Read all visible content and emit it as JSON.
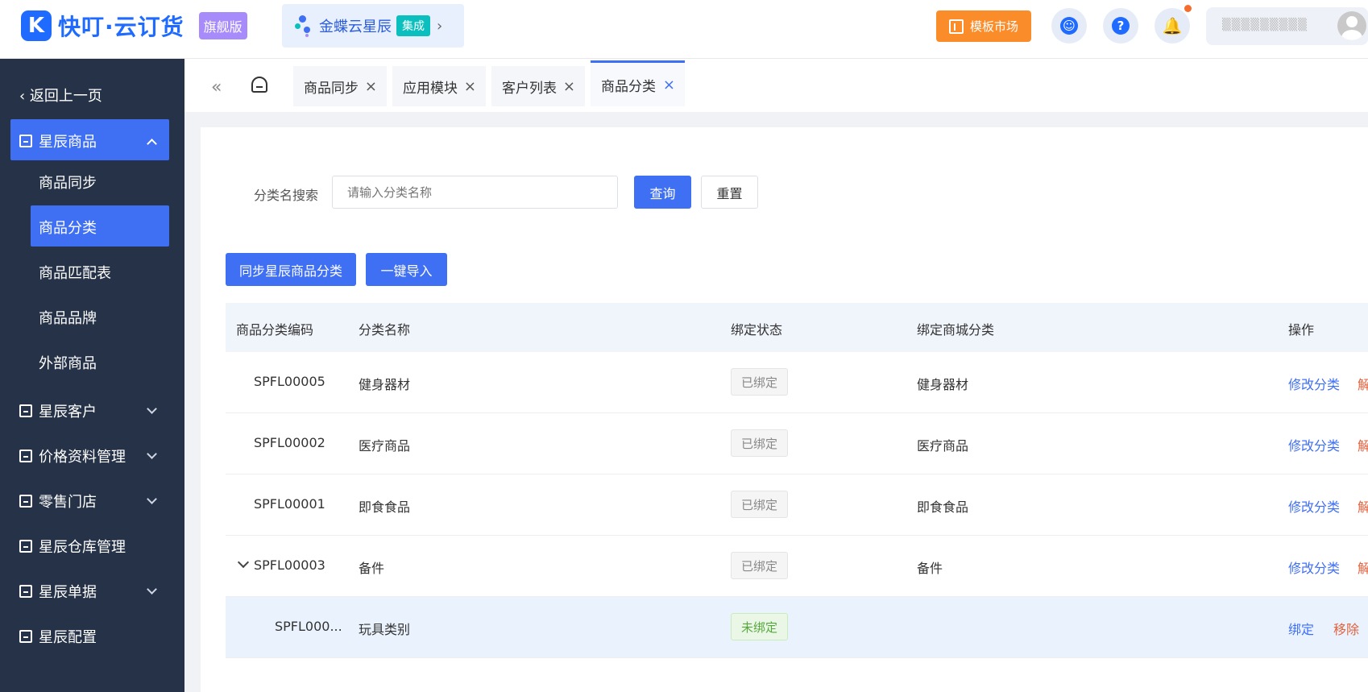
{
  "header": {
    "logo_mark": "K",
    "brand_name": "快叮·云订货",
    "edition_badge": "旗舰版",
    "kingdee_name": "金蝶云星辰",
    "kingdee_tag": "集成",
    "market_button": "模板市场",
    "help_icon_text": "?",
    "user_name": "▒▒▒▒▒▒▒▒▒"
  },
  "sidebar": {
    "back_label": "返回上一页",
    "groups": [
      {
        "label": "星辰商品"
      },
      {
        "label": "星辰客户"
      },
      {
        "label": "价格资料管理"
      },
      {
        "label": "零售门店"
      },
      {
        "label": "星辰仓库管理"
      },
      {
        "label": "星辰单据"
      },
      {
        "label": "星辰配置"
      }
    ],
    "sub_items": [
      {
        "label": "商品同步"
      },
      {
        "label": "商品分类"
      },
      {
        "label": "商品匹配表"
      },
      {
        "label": "商品品牌"
      },
      {
        "label": "外部商品"
      }
    ]
  },
  "tabs": [
    {
      "label": "商品同步"
    },
    {
      "label": "应用模块"
    },
    {
      "label": "客户列表"
    },
    {
      "label": "商品分类"
    }
  ],
  "tab_close": "×",
  "search": {
    "label": "分类名搜索",
    "placeholder": "请输入分类名称",
    "query_button": "查询",
    "reset_button": "重置"
  },
  "actions": {
    "sync_button": "同步星辰商品分类",
    "import_button": "一键导入"
  },
  "table": {
    "columns": [
      "商品分类编码",
      "分类名称",
      "绑定状态",
      "绑定商城分类",
      "操作"
    ],
    "rows": [
      {
        "code": "SPFL00005",
        "name": "健身器材",
        "status": "已绑定",
        "mall_category": "健身器材",
        "action1": "修改分类",
        "action2": "解"
      },
      {
        "code": "SPFL00002",
        "name": "医疗商品",
        "status": "已绑定",
        "mall_category": "医疗商品",
        "action1": "修改分类",
        "action2": "解"
      },
      {
        "code": "SPFL00001",
        "name": "即食食品",
        "status": "已绑定",
        "mall_category": "即食食品",
        "action1": "修改分类",
        "action2": "解"
      },
      {
        "code": "SPFL00003",
        "name": "备件",
        "status": "已绑定",
        "mall_category": "备件",
        "action1": "修改分类",
        "action2": "解"
      },
      {
        "code": "SPFL000...",
        "name": "玩具类别",
        "status": "未绑定",
        "mall_category": "",
        "action1": "绑定",
        "action2": "移除"
      }
    ]
  },
  "colors": {
    "primary": "#3f6ff2",
    "sidebar_bg": "#263247",
    "market_orange": "#fb8c2a",
    "edition_purple": "#a78bfa",
    "warn": "#e0623e"
  }
}
